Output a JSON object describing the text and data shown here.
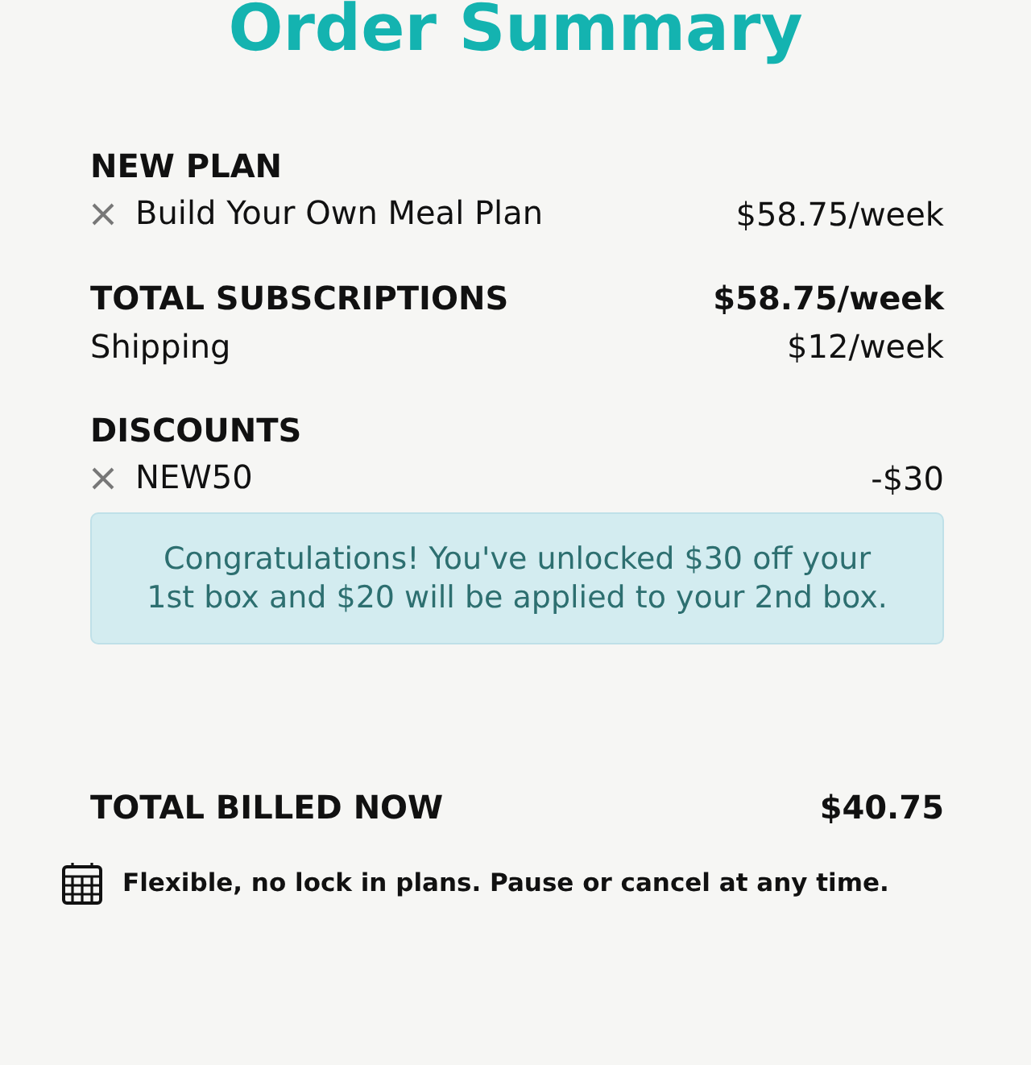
{
  "title": "Order Summary",
  "new_plan": {
    "heading": "NEW PLAN",
    "items": [
      {
        "name": "Build Your Own Meal Plan",
        "price": "$58.75/week"
      }
    ]
  },
  "total_subscriptions": {
    "label": "TOTAL SUBSCRIPTIONS",
    "value": "$58.75/week"
  },
  "shipping": {
    "label": "Shipping",
    "value": "$12/week"
  },
  "discounts": {
    "heading": "DISCOUNTS",
    "items": [
      {
        "name": "NEW50",
        "amount": "-$30"
      }
    ],
    "notice": "Congratulations! You've unlocked $30 off your 1st box and $20 will be applied to your 2nd box."
  },
  "total_billed": {
    "label": "TOTAL BILLED NOW",
    "value": "$40.75"
  },
  "footer_note": "Flexible, no lock in plans. Pause or cancel at any time."
}
